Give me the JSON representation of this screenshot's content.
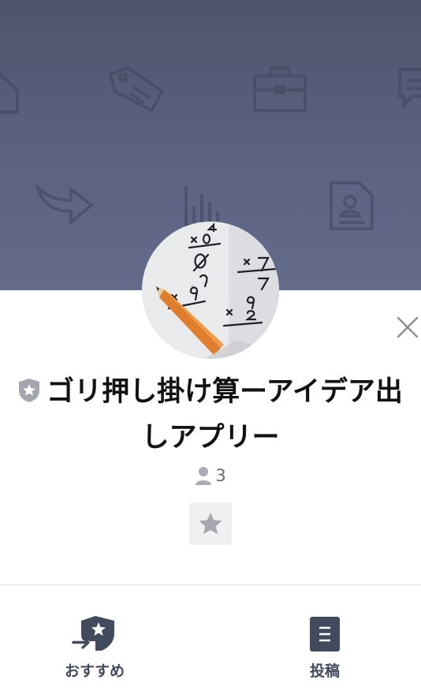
{
  "profile": {
    "title": "ゴリ押し掛け算ーアイデア出しアプリー",
    "member_count": "3"
  },
  "nav": {
    "items": [
      {
        "label": "おすすめ",
        "icon": "recommend-icon"
      },
      {
        "label": "投稿",
        "icon": "posts-icon"
      }
    ]
  },
  "colors": {
    "cover": "#5c6382",
    "nav_text": "#424a5e",
    "icon_gray": "#9a9ba0"
  },
  "avatar": {
    "content": "math-worksheet-with-pencil"
  }
}
